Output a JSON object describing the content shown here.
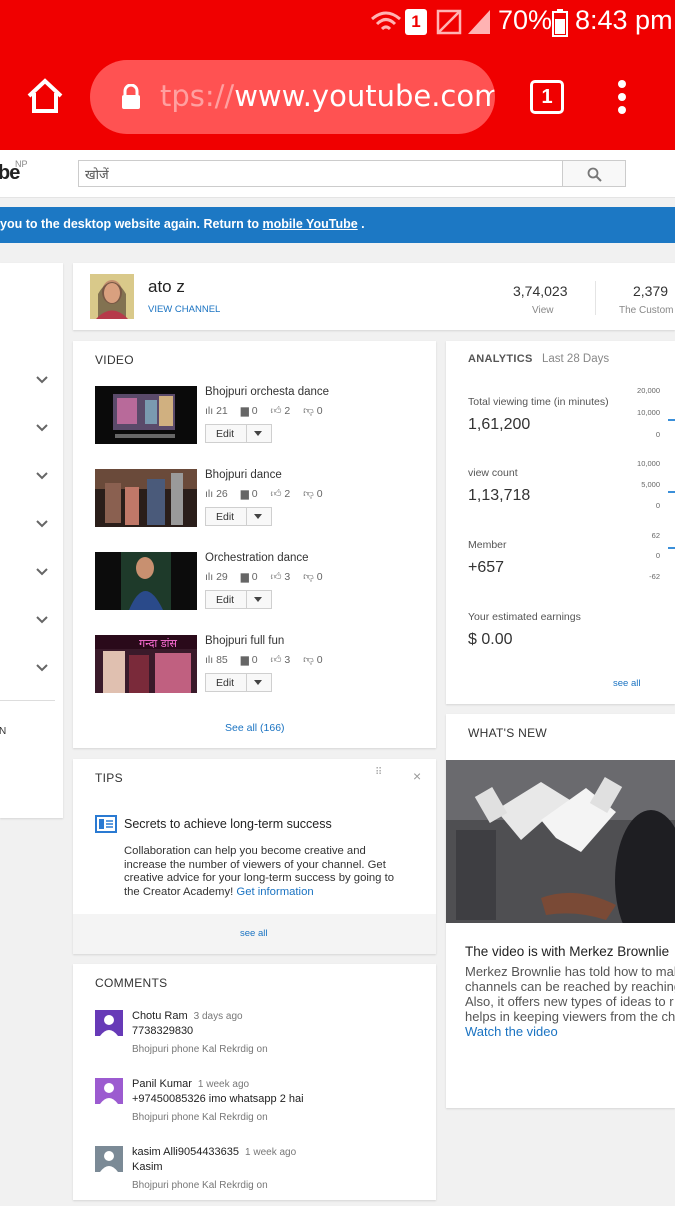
{
  "status_bar": {
    "notification_count": "1",
    "battery": "70%",
    "time": "8:43 pm"
  },
  "browser": {
    "url_faded": "tps://",
    "url": "www.youtube.com",
    "tabs_count": "1"
  },
  "header": {
    "logo": "be",
    "region": "NP",
    "search_placeholder": "खोजें"
  },
  "banner": {
    "text": "you to the desktop website again. Return to ",
    "link": "mobile YouTube",
    "tail": " ."
  },
  "sidebar": {
    "footer_letter": "N"
  },
  "channel": {
    "name": "ato z",
    "view_channel": "VIEW CHANNEL",
    "views_value": "3,74,023",
    "views_label": "View",
    "subs_value": "2,379",
    "subs_label": "The Custom"
  },
  "videos": {
    "title": "VIDEO",
    "edit_label": "Edit",
    "see_all": "See all (166)",
    "items": [
      {
        "title": "Bhojpuri orchesta dance",
        "views": "21",
        "comments": "0",
        "likes": "2",
        "dislikes": "0"
      },
      {
        "title": "Bhojpuri dance",
        "views": "26",
        "comments": "0",
        "likes": "2",
        "dislikes": "0"
      },
      {
        "title": "Orchestration dance",
        "views": "29",
        "comments": "0",
        "likes": "3",
        "dislikes": "0"
      },
      {
        "title": "Bhojpuri full fun",
        "views": "85",
        "comments": "0",
        "likes": "3",
        "dislikes": "0",
        "thumb_text": "गन्दा डांस"
      }
    ]
  },
  "analytics": {
    "title": "ANALYTICS",
    "period": "Last 28 Days",
    "watch_label": "Total viewing time (in minutes)",
    "watch_value": "1,61,200",
    "watch_axis": [
      "20,000",
      "10,000",
      "0"
    ],
    "viewcount_label": "view count",
    "viewcount_value": "1,13,718",
    "viewcount_axis": [
      "10,000",
      "5,000",
      "0"
    ],
    "member_label": "Member",
    "member_value": "+657",
    "member_axis": [
      "62",
      "0",
      "-62"
    ],
    "earnings_label": "Your estimated earnings",
    "earnings_value": "$ 0.00",
    "see_all": "see all"
  },
  "tips": {
    "title": "TIPS",
    "heading": "Secrets to achieve long-term success",
    "body_lines": [
      "Collaboration can help you become creative and",
      "increase the number of viewers of your channel. Get",
      "creative advice for your long-term success by going to",
      "the Creator Academy! "
    ],
    "link": "Get information",
    "see_all": "see all",
    "close": "×"
  },
  "whats_new": {
    "title": "WHAT'S NEW",
    "headline": "The video is with Merkez Brownlie",
    "body_lines": [
      "Merkez Brownlie has told how to mak",
      "channels can be reached by reaching",
      "Also, it offers new types of ideas to r",
      "helps in keeping viewers from the ch"
    ],
    "link": "Watch the video"
  },
  "comments": {
    "title": "COMMENTS",
    "items": [
      {
        "name": "Chotu Ram",
        "time": "3 days ago",
        "text": "7738329830",
        "on": "Bhojpuri phone Kal Rekrdig on"
      },
      {
        "name": "Panil Kumar",
        "time": "1 week ago",
        "text": "+97450085326 imo whatsapp 2 hai",
        "on": "Bhojpuri phone Kal Rekrdig on"
      },
      {
        "name": "kasim Alli9054433635",
        "time": "1 week ago",
        "text": "Kasim",
        "on": "Bhojpuri phone Kal Rekrdig on"
      }
    ]
  },
  "colors": {
    "brand_red": "#f00000",
    "banner_blue": "#1c78c4",
    "link_blue": "#1a73c2"
  }
}
